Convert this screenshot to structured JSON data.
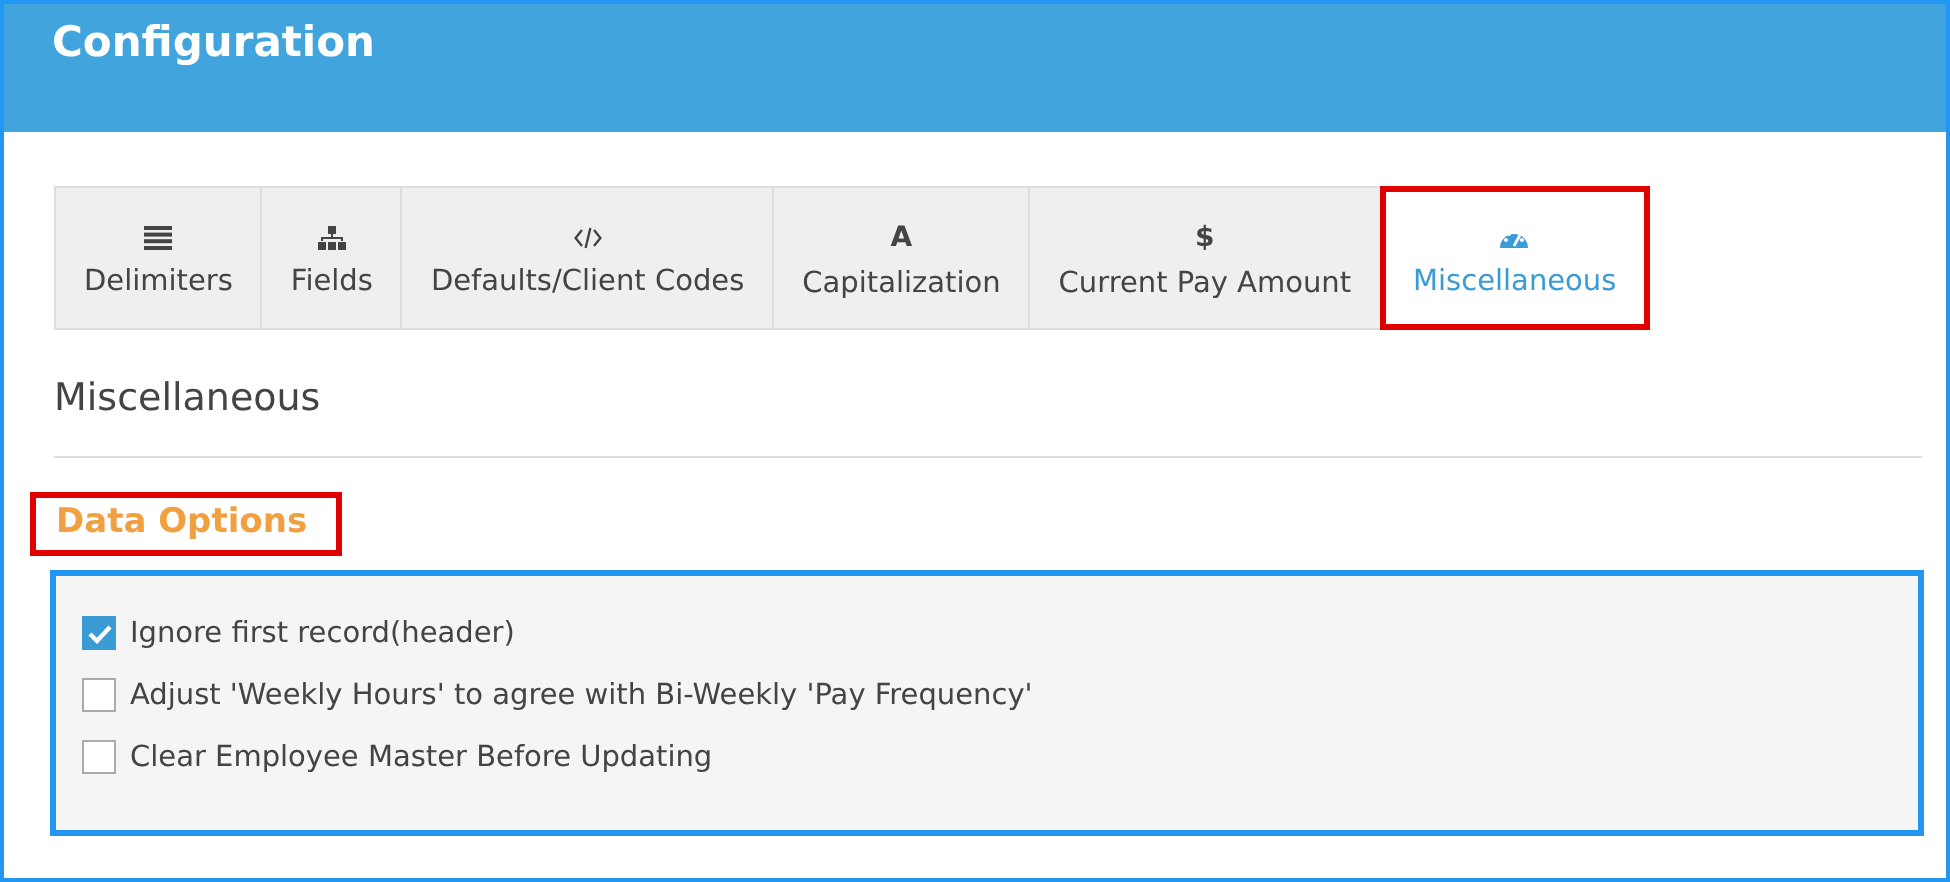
{
  "header": {
    "title": "Configuration"
  },
  "tabs": [
    {
      "label": "Delimiters",
      "icon": {
        "kind": "lines"
      },
      "selected": false
    },
    {
      "label": "Fields",
      "icon": {
        "kind": "sitemap"
      },
      "selected": false
    },
    {
      "label": "Defaults/Client Codes",
      "icon": {
        "kind": "code"
      },
      "selected": false
    },
    {
      "label": "Capitalization",
      "icon": {
        "kind": "glyph",
        "text": "A"
      },
      "selected": false
    },
    {
      "label": "Current Pay Amount",
      "icon": {
        "kind": "glyph",
        "text": "$"
      },
      "selected": false
    },
    {
      "label": "Miscellaneous",
      "icon": {
        "kind": "gauge"
      },
      "selected": true
    }
  ],
  "page_heading": "Miscellaneous",
  "section": {
    "title": "Data Options",
    "highlighted": true
  },
  "options_panel": {
    "highlighted": true,
    "options": [
      {
        "label": "Ignore first record(header)",
        "checked": true
      },
      {
        "label": "Adjust 'Weekly Hours' to agree with Bi-Weekly 'Pay Frequency'",
        "checked": false
      },
      {
        "label": "Clear Employee Master Before Updating",
        "checked": false
      }
    ]
  }
}
